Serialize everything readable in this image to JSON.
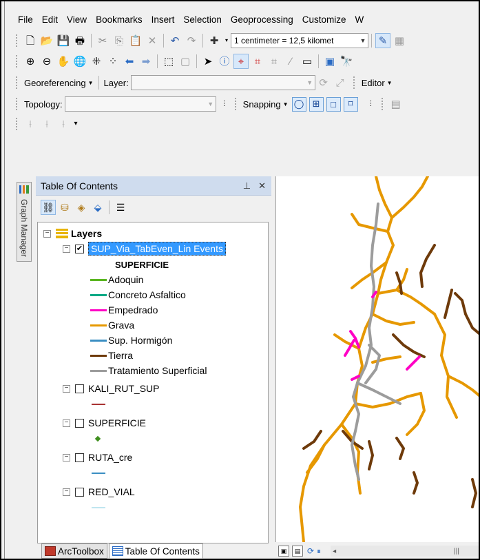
{
  "menu": [
    "File",
    "Edit",
    "View",
    "Bookmarks",
    "Insert",
    "Selection",
    "Geoprocessing",
    "Customize",
    "W"
  ],
  "toolbar": {
    "scale": "1 centimeter = 12,5 kilomet",
    "georeferencing_label": "Georeferencing",
    "layer_label": "Layer:",
    "editor_label": "Editor",
    "topology_label": "Topology:",
    "snapping_label": "Snapping"
  },
  "side_tab": {
    "label": "Graph Manager"
  },
  "toc": {
    "title": "Table Of Contents",
    "pin_close": "Θ ✕",
    "root": "Layers",
    "layers": [
      {
        "name": "SUP_Via_TabEven_Lin Events",
        "checked": true,
        "field": "SUPERFICIE",
        "classes": [
          {
            "label": "Adoquin",
            "color": "#5ab521"
          },
          {
            "label": "Concreto Asfaltico",
            "color": "#00a884"
          },
          {
            "label": "Empedrado",
            "color": "#ff00c5"
          },
          {
            "label": "Grava",
            "color": "#e69800"
          },
          {
            "label": "Sup. Hormigón",
            "color": "#3a8ec2"
          },
          {
            "label": "Tierra",
            "color": "#6e3a0a"
          },
          {
            "label": "Tratamiento Superficial",
            "color": "#9c9c9c"
          }
        ]
      },
      {
        "name": "KALI_RUT_SUP",
        "checked": false,
        "symbol": "line",
        "color": "#a83232"
      },
      {
        "name": "SUPERFICIE",
        "checked": false,
        "symbol": "point",
        "color": "#3f8f1e"
      },
      {
        "name": "RUTA_cre",
        "checked": false,
        "symbol": "line",
        "color": "#3a8ec2"
      },
      {
        "name": "RED_VIAL",
        "checked": false,
        "symbol": "line",
        "color": "#bfe6f0"
      }
    ]
  },
  "bottom_tabs": [
    "ArcToolbox",
    "Table Of Contents"
  ],
  "colors": {
    "selection": "#3399ff",
    "grava": "#e69800",
    "tierra": "#6e3a0a",
    "tratamiento": "#9c9c9c",
    "empedrado": "#ff00c5"
  }
}
